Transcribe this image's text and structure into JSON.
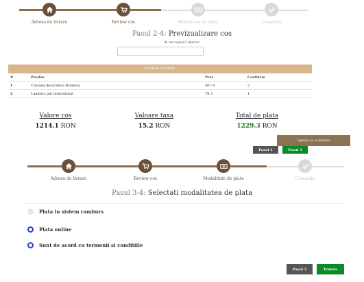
{
  "stepper_top": {
    "steps": [
      {
        "label": "Adresa de livrare",
        "icon": "home-icon",
        "state": "done"
      },
      {
        "label": "Review cos",
        "icon": "cart-icon",
        "state": "done"
      },
      {
        "label": "Modalitate de plata",
        "icon": "money-icon",
        "state": "todo"
      },
      {
        "label": "Comanda",
        "icon": "check-icon",
        "state": "todo"
      }
    ]
  },
  "review": {
    "step_number": "Pasul 2-4:",
    "step_title": "Previzualizare cos",
    "coupon_link": "Ai un cupon? Aplica!",
    "coupon_placeholder": ""
  },
  "products": {
    "title": "Produse achizitie",
    "columns": [
      "#",
      "Produs",
      "Pret",
      "Cantitate"
    ],
    "rows": [
      {
        "index": "1",
        "name": "Coloana decorativa Bizantiq",
        "price": "567.9",
        "qty": "2"
      },
      {
        "index": "2",
        "name": "Lambriu pin termotratat",
        "price": "78.3",
        "qty": "1"
      }
    ]
  },
  "totals": {
    "cart_label": "Valore cos",
    "cart_value": "1214.1",
    "cart_unit": "RON",
    "tax_label": "Valoare taxa",
    "tax_value": "15.2",
    "tax_unit": "RON",
    "total_label": "Total de plata",
    "total_value": "1229.3",
    "total_unit": "RON"
  },
  "feedback_label": "Opinia ta conteaza",
  "review_buttons": {
    "prev": "Pasul 1",
    "next": "Pasul 3"
  },
  "stepper_bottom": {
    "steps": [
      {
        "label": "Adresa de livrare",
        "icon": "home-icon",
        "state": "done"
      },
      {
        "label": "Review cos",
        "icon": "cart-icon",
        "state": "done"
      },
      {
        "label": "Modalitate de plata",
        "icon": "money-icon",
        "state": "done"
      },
      {
        "label": "Comanda",
        "icon": "check-icon",
        "state": "todo"
      }
    ]
  },
  "payment": {
    "step_number": "Pasul 3-4:",
    "step_title": "Selectati modalitatea de plata",
    "options": [
      {
        "label": "Plata in sistem ramburs",
        "selected": false
      },
      {
        "label": "Plata online",
        "selected": true
      },
      {
        "label": "Sunt de acord cu termenii si conditiile",
        "selected": true
      }
    ]
  },
  "payment_buttons": {
    "prev": "Pasul 3",
    "submit": "Trimite"
  },
  "colors": {
    "accent": "#8a6d4c",
    "table_header": "#d7b68d",
    "success": "#0a8a2a",
    "radio": "#1f3fcf"
  }
}
